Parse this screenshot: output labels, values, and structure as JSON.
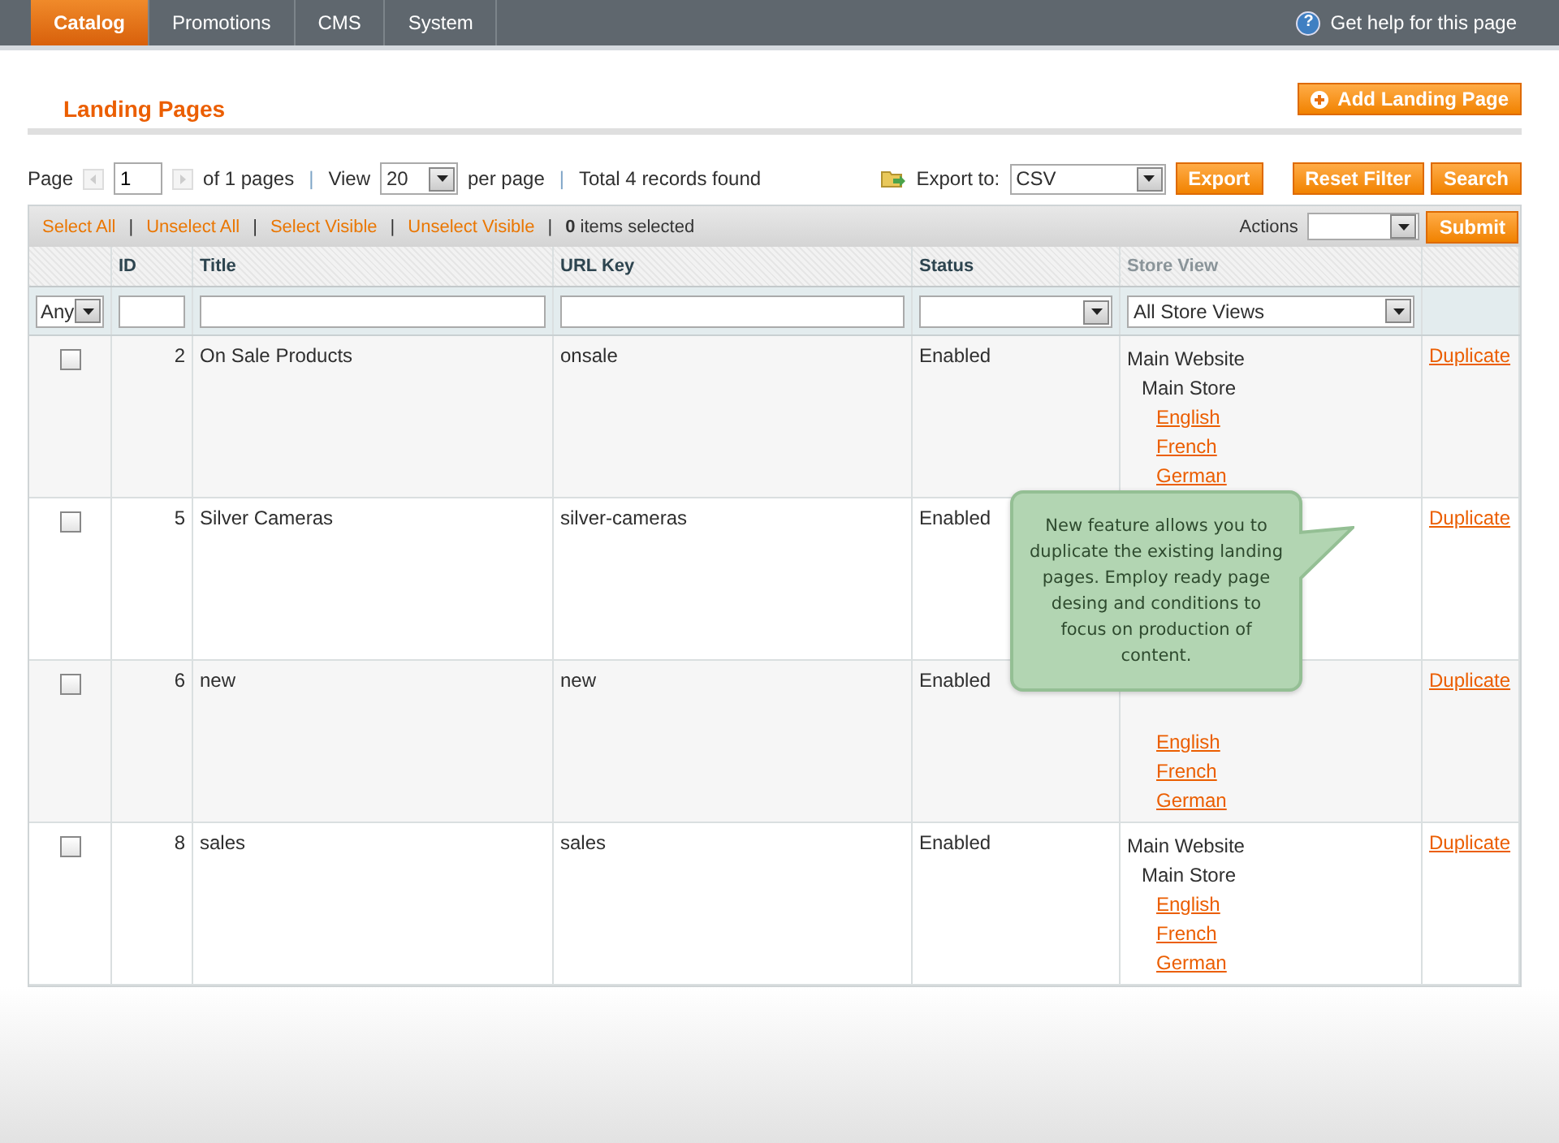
{
  "nav": {
    "tabs": [
      {
        "label": "Catalog",
        "selected": true
      },
      {
        "label": "Promotions",
        "selected": false
      },
      {
        "label": "CMS",
        "selected": false
      },
      {
        "label": "System",
        "selected": false
      }
    ],
    "help_icon": "?",
    "help": "Get help for this page"
  },
  "page_title": "Landing Pages",
  "add_button": "Add Landing Page",
  "pager": {
    "page_label": "Page",
    "page": "1",
    "of_pages": "of 1 pages",
    "view_label": "View",
    "per_page": "20",
    "per_page_label": "per page",
    "separator": "|",
    "total": "Total 4 records found"
  },
  "export": {
    "label": "Export to:",
    "format": "CSV",
    "button": "Export"
  },
  "filter_buttons": [
    "Reset Filter",
    "Search"
  ],
  "massaction": {
    "links": [
      "Select All",
      "Unselect All",
      "Select Visible",
      "Unselect Visible"
    ],
    "separator": "|",
    "selected": "**0** items selected",
    "actions_label": "Actions",
    "submit": "Submit"
  },
  "table": {
    "columns": [
      {},
      {
        "label": "ID",
        "disabled": false
      },
      {
        "label": "Title",
        "disabled": false
      },
      {
        "label": "URL Key",
        "disabled": false
      },
      {
        "label": "Status",
        "disabled": false
      },
      {
        "label": "Store View",
        "disabled": true
      },
      {}
    ],
    "filters": {
      "any": "Any",
      "store_view": "All Store Views"
    },
    "rows": [
      {
        "checked": false,
        "id": "2",
        "title": "On Sale Products",
        "url_key": "onsale",
        "status": "Enabled",
        "store_view": [
          {
            "kind": "website",
            "text": "Main Website"
          },
          {
            "kind": "store",
            "text": "Main Store"
          },
          {
            "kind": "view",
            "text": "English"
          },
          {
            "kind": "view",
            "text": "French"
          },
          {
            "kind": "view",
            "text": "German"
          }
        ],
        "action": "Duplicate"
      },
      {
        "checked": false,
        "id": "5",
        "title": "Silver Cameras",
        "url_key": "silver-cameras",
        "status": "Enabled",
        "store_view": [],
        "action": "Duplicate"
      },
      {
        "checked": false,
        "id": "6",
        "title": "new",
        "url_key": "new",
        "status": "Enabled",
        "store_view": [
          {
            "kind": "gap"
          },
          {
            "kind": "gap"
          },
          {
            "kind": "view",
            "text": "English"
          },
          {
            "kind": "view",
            "text": "French"
          },
          {
            "kind": "view",
            "text": "German"
          }
        ],
        "action": "Duplicate"
      },
      {
        "checked": false,
        "id": "8",
        "title": "sales",
        "url_key": "sales",
        "status": "Enabled",
        "store_view": [
          {
            "kind": "website",
            "text": "Main Website"
          },
          {
            "kind": "store",
            "text": "Main Store"
          },
          {
            "kind": "view",
            "text": "English"
          },
          {
            "kind": "view",
            "text": "French"
          },
          {
            "kind": "view",
            "text": "German"
          }
        ],
        "action": "Duplicate"
      }
    ]
  },
  "tooltip": "New feature allows you to duplicate the existing landing pages. Employ ready page desing and conditions to focus on production of content."
}
